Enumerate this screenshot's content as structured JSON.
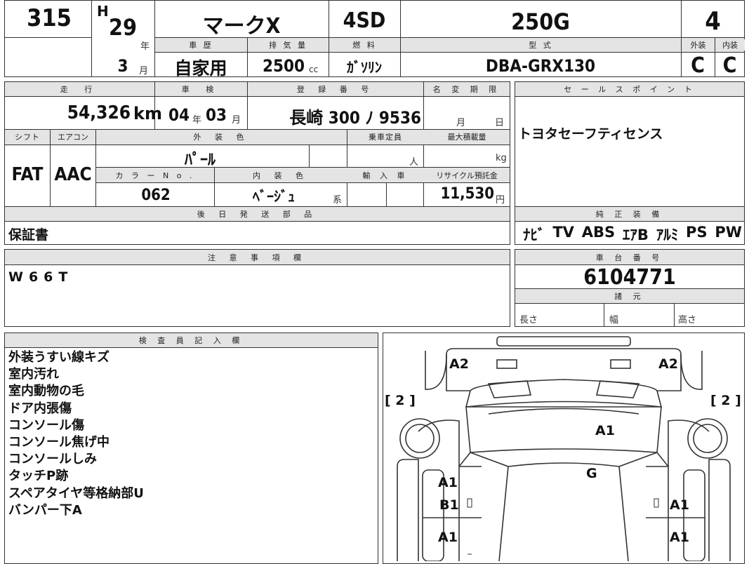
{
  "lot": {
    "number": "315"
  },
  "year": {
    "era": "H",
    "year": "29",
    "year_unit": "年",
    "month": "3",
    "month_unit": "月"
  },
  "model": {
    "name": "マークX",
    "body": "4SD",
    "grade": "250G",
    "score": "4"
  },
  "labels": {
    "history": "車 歴",
    "displacement": "排 気 量",
    "fuel": "燃 料",
    "model_code": "型 式",
    "exterior": "外装",
    "interior": "内装",
    "mileage": "走 行",
    "inspection": "車 検",
    "registration": "登 録 番 号",
    "name_change": "名 変 期 限",
    "sales_point": "セ ー ル ス ポ イ ン ト",
    "shift": "シフト",
    "aircon": "エアコン",
    "ext_color": "外 装 色",
    "capacity": "乗車定員",
    "max_load": "最大積載量",
    "color_no": "カ ラ ー N o .",
    "int_color": "内 装 色",
    "import": "輸 入 車",
    "recycle": "リサイクル預託金",
    "later_parts": "後 日 発 送 部 品",
    "equipment": "純 正 装 備",
    "notes": "注 意 事 項 欄",
    "chassis": "車 台 番 号",
    "specs": "諸 元",
    "length": "長さ",
    "width": "幅",
    "height": "高さ",
    "inspector": "検 査 員 記 入 欄"
  },
  "values": {
    "history": "自家用",
    "displacement": "2500",
    "cc": "cc",
    "fuel": "ｶﾞｿﾘﾝ",
    "model_code": "DBA-GRX130",
    "ext_grade": "C",
    "int_grade": "C",
    "mileage": "54,326",
    "km": "km",
    "inspection_year": "04",
    "inspection_year_unit": "年",
    "inspection_month": "03",
    "inspection_month_unit": "月",
    "registration": "長崎 300 ﾉ 9536",
    "month_unit": "月",
    "day_unit": "日",
    "sales_point": "トヨタセーフティセンス",
    "shift": "FAT",
    "aircon": "AAC",
    "ext_color": "ﾊﾟｰﾙ",
    "person_unit": "人",
    "kg_unit": "kg",
    "color_no": "062",
    "int_color": "ﾍﾞｰｼﾞｭ",
    "kei": "系",
    "recycle": "11,530",
    "yen": "円",
    "later_parts": "保証書",
    "equipment": [
      "ﾅﾋﾞ",
      "TV",
      "ABS",
      "ｴｱB",
      "ｱﾙﾐ",
      "PS",
      "PW"
    ],
    "notes": "W66T",
    "chassis": "6104771"
  },
  "inspector_notes": [
    "外装うすい線キズ",
    "室内汚れ",
    "室内動物の毛",
    "ドア内張傷",
    "コンソール傷",
    "コンソール焦げ中",
    "コンソールしみ",
    "タッチP跡",
    "スペアタイヤ等格納部U",
    "バンパー下A"
  ],
  "diagram": {
    "a2_left": "A2",
    "a2_right": "A2",
    "tire_left": "[ 2 ]",
    "tire_right": "[ 2 ]",
    "hood": "A1",
    "glass": "G",
    "front_left_door": "A1",
    "front_left_door2": "B1",
    "front_right_door": "A1",
    "rear_left_door": "A1",
    "rear_right_door": "A1"
  }
}
